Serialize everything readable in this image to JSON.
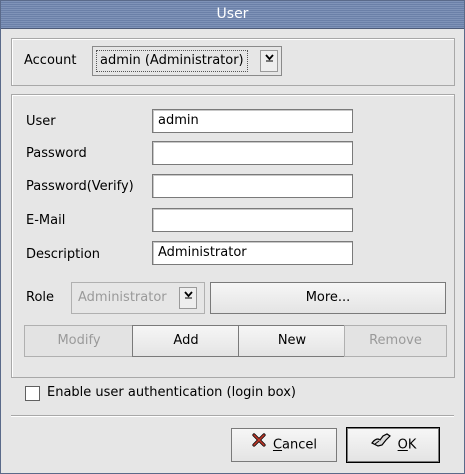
{
  "window": {
    "title": "User"
  },
  "account": {
    "label": "Account",
    "value": "admin (Administrator)"
  },
  "form": {
    "user_label": "User",
    "user_value": "admin",
    "password_label": "Password",
    "password_value": "",
    "password_verify_label": "Password(Verify)",
    "password_verify_value": "",
    "email_label": "E-Mail",
    "email_value": "",
    "description_label": "Description",
    "description_value": "Administrator"
  },
  "role": {
    "label": "Role",
    "value": "Administrator",
    "more_label": "More..."
  },
  "actions": {
    "modify": "Modify",
    "add": "Add",
    "new": "New",
    "remove": "Remove"
  },
  "auth": {
    "label": "Enable user authentication (login box)",
    "checked": false
  },
  "footer": {
    "cancel_prefix": "",
    "cancel_mnemonic": "C",
    "cancel_rest": "ancel",
    "ok_mnemonic": "O",
    "ok_rest": "K"
  },
  "icons": {
    "combo_arrow": "chevron-down-icon",
    "cancel": "cancel-x-icon",
    "ok": "ok-check-icon"
  }
}
